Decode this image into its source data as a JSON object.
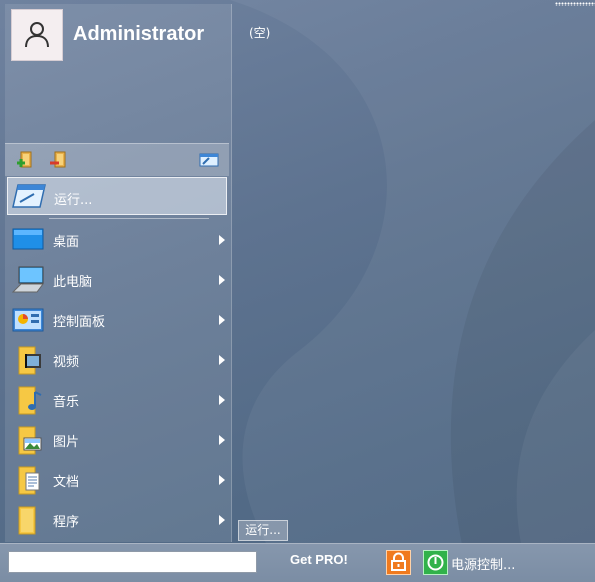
{
  "user": {
    "name": "Administrator"
  },
  "toolbar": {
    "buttons": [
      "add-item-icon",
      "remove-item-icon",
      "window-icon"
    ]
  },
  "run": {
    "label": "运行..."
  },
  "menu": {
    "items": [
      {
        "label": "桌面",
        "icon": "desktop-icon"
      },
      {
        "label": "此电脑",
        "icon": "computer-icon"
      },
      {
        "label": "控制面板",
        "icon": "control-panel-icon"
      },
      {
        "label": "视频",
        "icon": "video-folder-icon"
      },
      {
        "label": "音乐",
        "icon": "music-folder-icon"
      },
      {
        "label": "图片",
        "icon": "pictures-folder-icon"
      },
      {
        "label": "文档",
        "icon": "documents-folder-icon"
      },
      {
        "label": "程序",
        "icon": "programs-folder-icon"
      }
    ]
  },
  "right_pane": {
    "empty_label": "(空)",
    "run_button": "运行..."
  },
  "bottom": {
    "search_value": "",
    "get_pro": "Get PRO!",
    "power_label": "电源控制..."
  },
  "colors": {
    "lock_button": "#f07a1e",
    "power_button": "#31b24a",
    "folder": "#f6c844"
  }
}
